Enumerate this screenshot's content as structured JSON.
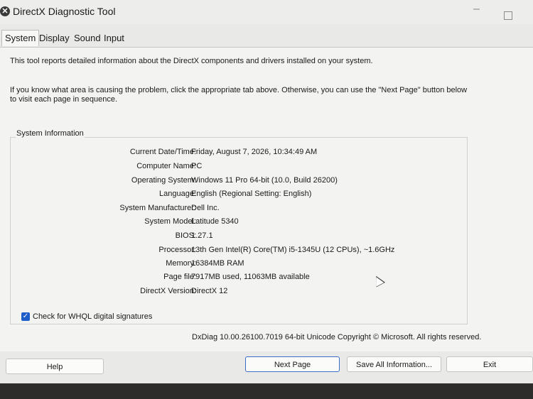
{
  "window": {
    "title": "DirectX Diagnostic Tool",
    "app_icon": "close-x-icon"
  },
  "tabs": [
    {
      "label": "System",
      "active": true
    },
    {
      "label": "Display",
      "active": false
    },
    {
      "label": "Sound",
      "active": false
    },
    {
      "label": "Input",
      "active": false
    }
  ],
  "intro": {
    "line1": "This tool reports detailed information about the DirectX components and drivers installed on your system.",
    "line2": "If you know what area is causing the problem, click the appropriate tab above.  Otherwise, you can use the \"Next Page\" button below to visit each page in sequence."
  },
  "system_info": {
    "title": "System Information",
    "rows": [
      {
        "label": "Current Date/Time:",
        "value": "Friday, August 7, 2026, 10:34:49 AM"
      },
      {
        "label": "Computer Name:",
        "value": "PC"
      },
      {
        "label": "Operating System:",
        "value": "Windows 11 Pro 64-bit (10.0, Build 26200)"
      },
      {
        "label": "Language:",
        "value": "English (Regional Setting: English)"
      },
      {
        "label": "System Manufacturer:",
        "value": "Dell Inc."
      },
      {
        "label": "System Model:",
        "value": "Latitude 5340"
      },
      {
        "label": "BIOS:",
        "value": "1.27.1"
      },
      {
        "label": "Processor:",
        "value": "13th Gen Intel(R) Core(TM) i5-1345U (12 CPUs), ~1.6GHz"
      },
      {
        "label": "Memory:",
        "value": "16384MB RAM"
      },
      {
        "label": "Page file:",
        "value": "7917MB used, 11063MB available"
      },
      {
        "label": "DirectX Version:",
        "value": "DirectX 12"
      }
    ]
  },
  "whql": {
    "label": "Check for WHQL digital signatures",
    "checked": true
  },
  "footer": "DxDiag 10.00.26100.7019 64-bit Unicode  Copyright © Microsoft. All rights reserved.",
  "buttons": {
    "help": "Help",
    "next_page": "Next Page",
    "save_all": "Save All Information...",
    "exit": "Exit"
  },
  "colors": {
    "checkbox": "#1f5ec8",
    "focus_border": "#3b6cc6"
  }
}
